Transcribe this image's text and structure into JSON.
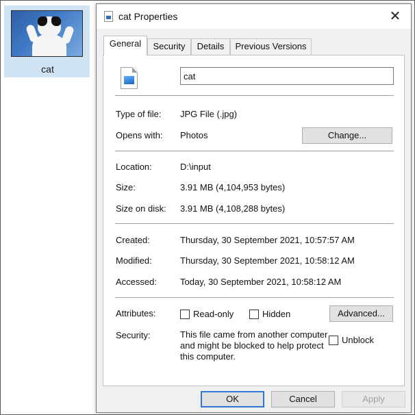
{
  "desktop": {
    "item_label": "cat"
  },
  "dialog": {
    "title": "cat Properties",
    "close_glyph": "✕",
    "tabs": [
      {
        "label": "General",
        "active": true
      },
      {
        "label": "Security",
        "active": false
      },
      {
        "label": "Details",
        "active": false
      },
      {
        "label": "Previous Versions",
        "active": false
      }
    ],
    "general": {
      "file_name": "cat",
      "type_label": "Type of file:",
      "type_value": "JPG File (.jpg)",
      "opens_label": "Opens with:",
      "opens_value": "Photos",
      "change_button": "Change...",
      "location_label": "Location:",
      "location_value": "D:\\input",
      "size_label": "Size:",
      "size_value": "3.91 MB (4,104,953 bytes)",
      "size_on_disk_label": "Size on disk:",
      "size_on_disk_value": "3.91 MB (4,108,288 bytes)",
      "created_label": "Created:",
      "created_value": "Thursday, 30 September 2021, 10:57:57 AM",
      "modified_label": "Modified:",
      "modified_value": "Thursday, 30 September 2021, 10:58:12 AM",
      "accessed_label": "Accessed:",
      "accessed_value": "Today, 30 September 2021, 10:58:12 AM",
      "attributes_label": "Attributes:",
      "readonly_label": "Read-only",
      "readonly_checked": false,
      "hidden_label": "Hidden",
      "hidden_checked": false,
      "advanced_button": "Advanced...",
      "security_label": "Security:",
      "security_text": "This file came from another computer and might be blocked to help protect this computer.",
      "unblock_label": "Unblock",
      "unblock_checked": false
    },
    "buttons": {
      "ok": "OK",
      "cancel": "Cancel",
      "apply": "Apply"
    }
  },
  "colors": {
    "accent": "#2f77d1",
    "selection": "#cfe3f3",
    "dialog_bg": "#f0f0f0"
  }
}
